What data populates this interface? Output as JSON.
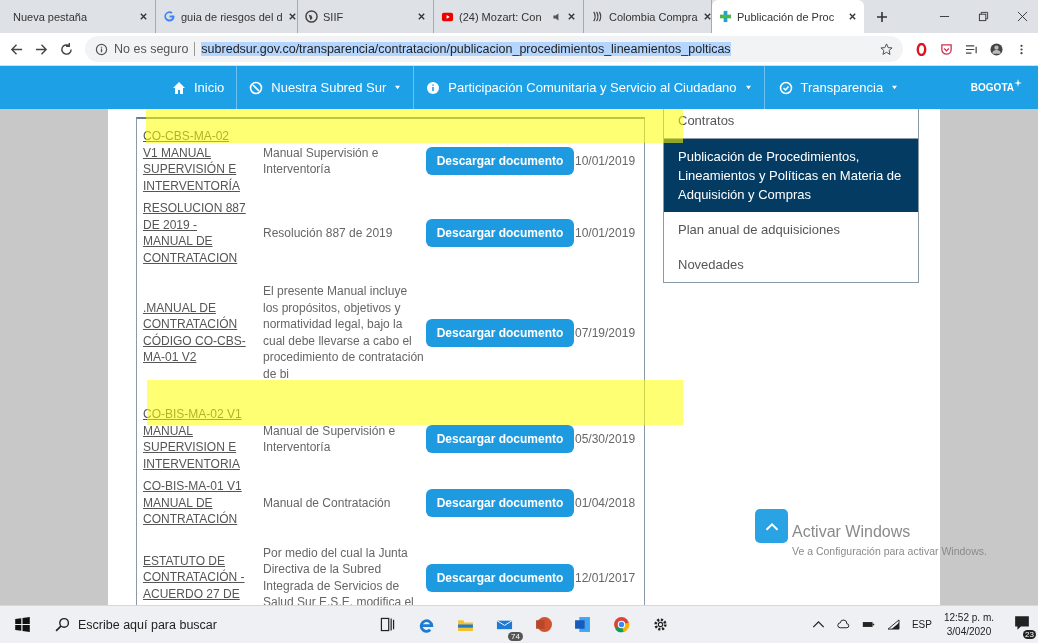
{
  "browser": {
    "tabs": [
      {
        "title": "Nueva pestaña",
        "selected": false
      },
      {
        "title": "guia de riesgos del d",
        "selected": false
      },
      {
        "title": "SIIF",
        "selected": false
      },
      {
        "title": "(24) Mozart: Con",
        "selected": false
      },
      {
        "title": "Colombia Compra",
        "selected": false
      },
      {
        "title": "Publicación de Proc",
        "selected": true
      }
    ],
    "security": "No es seguro",
    "url": "subredsur.gov.co/transparencia/contratacion/publicacion_procedimientos_lineamientos_polticas"
  },
  "nav": {
    "items": [
      {
        "label": "Inicio",
        "dropdown": false
      },
      {
        "label": "Nuestra Subred Sur",
        "dropdown": true
      },
      {
        "label": "Participación Comunitaria y Servicio al Ciudadano",
        "dropdown": true
      },
      {
        "label": "Transparencia",
        "dropdown": true
      }
    ],
    "logo": "BOGOTA"
  },
  "table": {
    "rows": [
      {
        "name": "CO-CBS-MA-02 V1 MANUAL SUPERVISIÓN E INTERVENTORÍA",
        "description": "Manual Supervisión e Interventoría",
        "button": "Descargar documento",
        "date": "10/01/2019"
      },
      {
        "name": "RESOLUCION 887 DE 2019 - MANUAL DE CONTRATACION",
        "description": "Resolución 887 de 2019",
        "button": "Descargar documento",
        "date": "10/01/2019"
      },
      {
        "name": ".MANUAL DE CONTRATACIÓN CÓDIGO CO-CBS-MA-01 V2",
        "description": "El presente Manual incluye los propósitos, objetivos y normatividad legal, bajo la cual debe llevarse a cabo el procedimiento de contratación de bi",
        "button": "Descargar documento",
        "date": "07/19/2019"
      },
      {
        "name": "CO-BIS-MA-02 V1 MANUAL SUPERVISION E INTERVENTORIA",
        "description": "Manual de Supervisión e Interventoría",
        "button": "Descargar documento",
        "date": "05/30/2019"
      },
      {
        "name": "CO-BIS-MA-01 V1 MANUAL DE CONTRATACIÓN",
        "description": "Manual de Contratación",
        "button": "Descargar documento",
        "date": "01/04/2018"
      },
      {
        "name": "ESTATUTO DE CONTRATACIÓN - ACUERDO 27 DE",
        "description": "Por medio del cual la Junta Directiva de la Subred Integrada de Servicios de Salud Sur E.S.E. modifica el",
        "button": "Descargar documento",
        "date": "12/01/2017"
      }
    ]
  },
  "sidebar": {
    "items": [
      {
        "label": "Contratos",
        "selected": false
      },
      {
        "label": "Publicación de Procedimientos, Lineamientos y Políticas en Materia de Adquisición y Compras",
        "selected": true
      },
      {
        "label": "Plan anual de adquisiciones",
        "selected": false
      },
      {
        "label": "Novedades",
        "selected": false
      }
    ]
  },
  "watermark": {
    "title": "Activar Windows",
    "subtitle": "Ve a Configuración para activar Windows."
  },
  "taskbar": {
    "search_placeholder": "Escribe aquí para buscar",
    "mail_badge": "74",
    "language": "ESP",
    "time": "12:52 p. m.",
    "date": "3/04/2020",
    "notifications": "23"
  }
}
